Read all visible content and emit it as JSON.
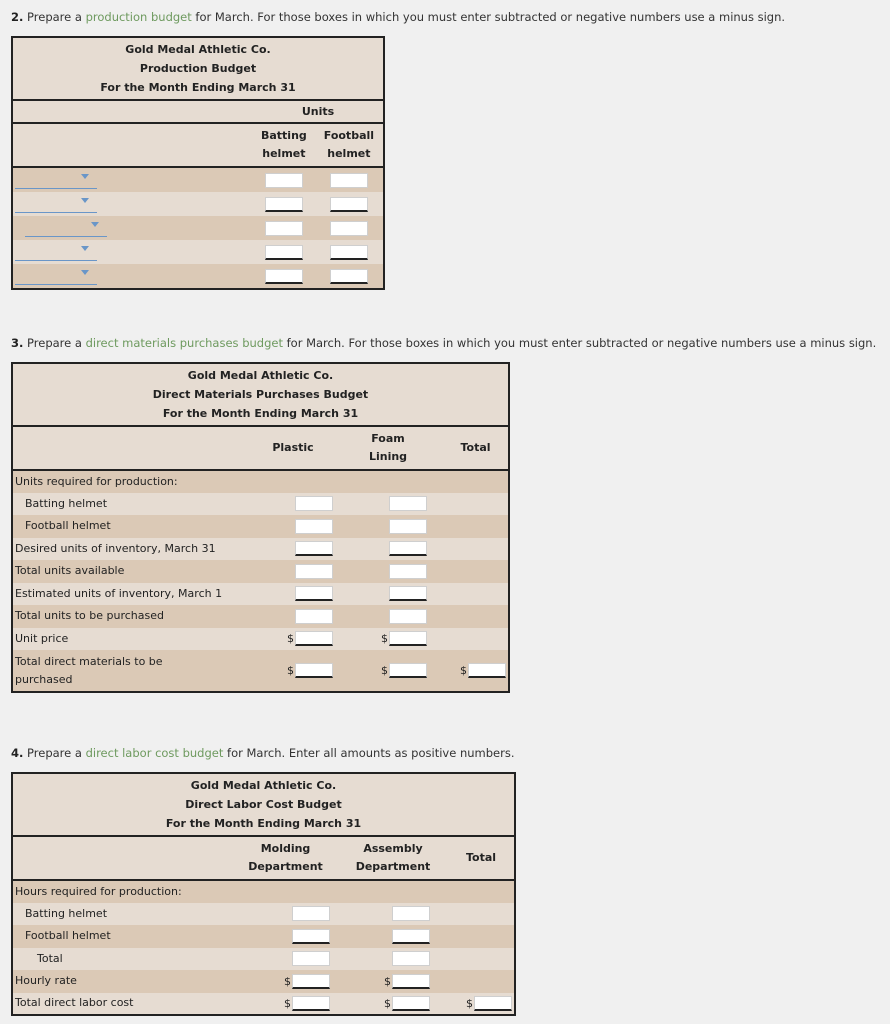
{
  "q2": {
    "number": "2.",
    "prefix": "Prepare a",
    "link": "production budget",
    "suffix": "for March. For those boxes in which you must enter subtracted or negative numbers use a minus sign.",
    "company": "Gold Medal Athletic Co.",
    "title": "Production Budget",
    "period": "For the Month Ending March 31",
    "units_header": "Units",
    "col1_line1": "Batting",
    "col1_line2": "helmet",
    "col2_line1": "Football",
    "col2_line2": "helmet",
    "rows": [
      {
        "dropdown_value": ""
      },
      {
        "dropdown_value": ""
      },
      {
        "dropdown_value": ""
      },
      {
        "dropdown_value": ""
      },
      {
        "dropdown_value": ""
      }
    ]
  },
  "q3": {
    "number": "3.",
    "prefix": "Prepare a",
    "link": "direct materials purchases budget",
    "suffix": "for March. For those boxes in which you must enter subtracted or negative numbers use a minus sign.",
    "company": "Gold Medal Athletic Co.",
    "title": "Direct Materials Purchases Budget",
    "period": "For the Month Ending March 31",
    "col_plastic": "Plastic",
    "col_foam_line1": "Foam",
    "col_foam_line2": "Lining",
    "col_total": "Total",
    "currency": "$",
    "rows": [
      "Units required for production:",
      "Batting helmet",
      "Football helmet",
      "Desired units of inventory, March 31",
      "Total units available",
      "Estimated units of inventory, March 1",
      "Total units to be purchased",
      "Unit price",
      "Total direct materials to be purchased"
    ]
  },
  "q4": {
    "number": "4.",
    "prefix": "Prepare a",
    "link": "direct labor cost budget",
    "suffix": "for March. Enter all amounts as positive numbers.",
    "company": "Gold Medal Athletic Co.",
    "title": "Direct Labor Cost Budget",
    "period": "For the Month Ending March 31",
    "col_molding_line1": "Molding",
    "col_molding_line2": "Department",
    "col_assembly_line1": "Assembly",
    "col_assembly_line2": "Department",
    "col_total": "Total",
    "currency": "$",
    "rows": [
      "Hours required for production:",
      "Batting helmet",
      "Football helmet",
      "Total",
      "Hourly rate",
      "Total direct labor cost"
    ]
  }
}
